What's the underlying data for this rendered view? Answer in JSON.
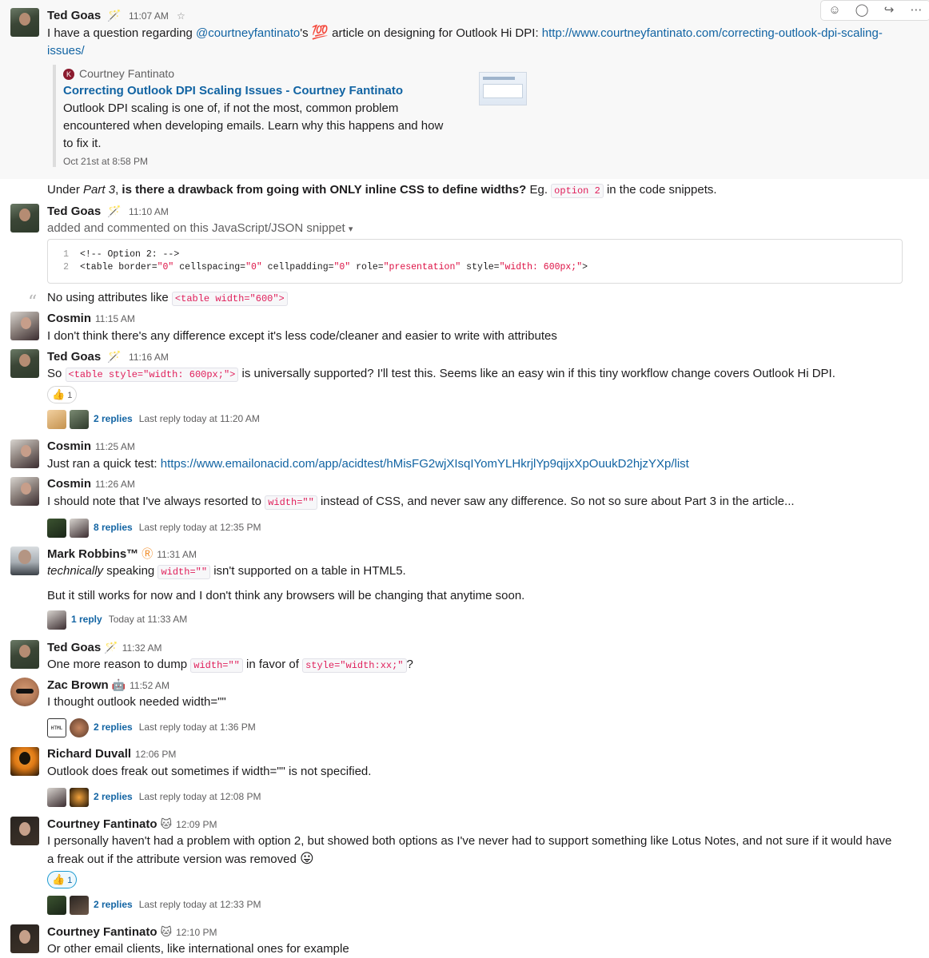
{
  "actions": {
    "add_reaction": "☺",
    "start_thread": "◯",
    "share": "↪",
    "more": "⋯"
  },
  "m1": {
    "name": "Ted Goas",
    "time": "11:07 AM",
    "pre": "I have a question regarding ",
    "mention": "@courtneyfantinato",
    "mid": "'s ",
    "emoji": "💯",
    "post": " article on designing for Outlook Hi DPI: ",
    "link": "http://www.courtneyfantinato.com/correcting-outlook-dpi-scaling-issues/"
  },
  "attachment": {
    "site": "Courtney Fantinato",
    "title": "Correcting Outlook DPI Scaling Issues - Courtney Fantinato",
    "desc": "Outlook DPI scaling is one of, if not the most, common problem encountered when developing emails. Learn why this happens and how to fix it.",
    "date": "Oct 21st at 8:58 PM"
  },
  "m1b": {
    "pre": "Under ",
    "em": "Part 3",
    "mid": ", ",
    "bold": "is there a drawback from going with ONLY inline CSS to define widths?",
    "post": " Eg. ",
    "code": "option 2",
    "tail": " in the code snippets."
  },
  "m2": {
    "name": "Ted Goas",
    "time": "11:10 AM",
    "text": "added and commented on this JavaScript/JSON snippet",
    "caret": "▾",
    "lines": [
      {
        "n": "1",
        "code": "<!-- Option 2: -->"
      },
      {
        "n": "2",
        "a": "<table border=",
        "s1": "\"0\"",
        "b": " cellspacing=",
        "s2": "\"0\"",
        "c": " cellpadding=",
        "s3": "\"0\"",
        "d": " role=",
        "s4": "\"presentation\"",
        "e": " style=",
        "s5": "\"width: 600px;\"",
        "f": ">"
      }
    ],
    "comment_pre": "No using attributes like ",
    "comment_code": "<table width=\"600\">"
  },
  "m3": {
    "name": "Cosmin",
    "time": "11:15 AM",
    "text": "I don't think there's any difference except it's less code/cleaner and easier to write with attributes"
  },
  "m4": {
    "name": "Ted Goas",
    "time": "11:16 AM",
    "pre": "So ",
    "code": "<table style=\"width: 600px;\">",
    "post": " is universally supported? I'll test this. Seems like an easy win if this tiny workflow change covers Outlook Hi DPI.",
    "reaction": "👍",
    "reaction_count": "1",
    "replies": "2 replies",
    "last": "Last reply today at 11:20 AM"
  },
  "m5": {
    "name": "Cosmin",
    "time": "11:25 AM",
    "pre": "Just ran a quick test: ",
    "link": "https://www.emailonacid.com/app/acidtest/hMisFG2wjXIsqIYomYLHkrjlYp9qijxXpOuukD2hjzYXp/list"
  },
  "m6": {
    "name": "Cosmin",
    "time": "11:26 AM",
    "pre": "I should note that I've always resorted to ",
    "code": "width=\"\"",
    "post": " instead of CSS, and never saw any difference. So not so sure about Part 3 in the article...",
    "replies": "8 replies",
    "last": "Last reply today at 12:35 PM"
  },
  "m7": {
    "name": "Mark Robbins™",
    "badge": "Ⓡ",
    "time": "11:31 AM",
    "em": "technically",
    "pre": " speaking ",
    "code": "width=\"\"",
    "post": " isn't supported on a table in HTML5.",
    "text2": "But it still works for now and I don't think any browsers will be changing that anytime soon.",
    "replies": "1 reply",
    "last": "Today at 11:33 AM"
  },
  "m8": {
    "name": "Ted Goas",
    "time": "11:32 AM",
    "pre": "One more reason to dump ",
    "code1": "width=\"\"",
    "mid": " in favor of ",
    "code2": "style=\"width:xx;\"",
    "post": "?"
  },
  "m9": {
    "name": "Zac Brown",
    "status": "🤖",
    "time": "11:52 AM",
    "text": "I thought outlook needed width=\"\"",
    "html_icon": "HTML",
    "replies": "2 replies",
    "last": "Last reply today at 1:36 PM"
  },
  "m10": {
    "name": "Richard Duvall",
    "time": "12:06 PM",
    "text": "Outlook does freak out sometimes if width=\"\" is not specified.",
    "replies": "2 replies",
    "last": "Last reply today at 12:08 PM"
  },
  "m11": {
    "name": "Courtney Fantinato",
    "status": "🐱",
    "time": "12:09 PM",
    "text": "I personally haven't had a problem with option 2, but showed both options as I've never had to support something like Lotus Notes, and not sure if it would have a freak out if the attribute version was removed ",
    "emoji": "😛",
    "reaction": "👍",
    "reaction_count": "1",
    "replies": "2 replies",
    "last": "Last reply today at 12:33 PM"
  },
  "m12": {
    "name": "Courtney Fantinato",
    "status": "🐱",
    "time": "12:10 PM",
    "text": "Or other email clients, like international ones for example"
  },
  "status_icons": {
    "ted": "🪄",
    "star": "☆"
  }
}
